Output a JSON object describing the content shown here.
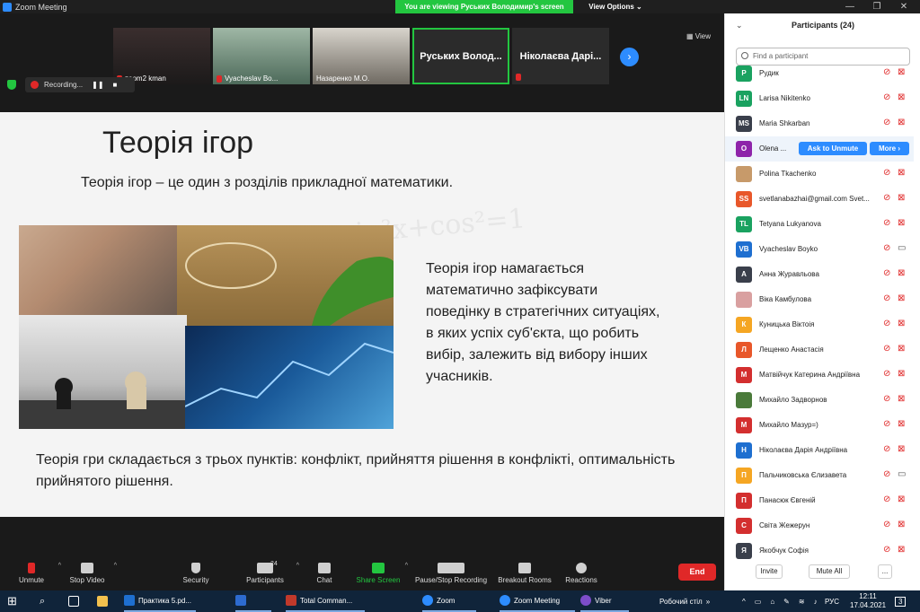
{
  "window": {
    "title": "Zoom Meeting",
    "banner": "You are viewing Руських Володимир's screen",
    "view_options": "View Options ⌄"
  },
  "thumbnails": [
    {
      "name": "zoom2 kman"
    },
    {
      "name": "Vyacheslav Bo..."
    },
    {
      "name": "Назаренко М.О."
    },
    {
      "name": "Руських  Волод..."
    },
    {
      "name": "Ніколаєва  Дарі..."
    }
  ],
  "view_label": "View",
  "recording": {
    "label": "Recording..."
  },
  "slide": {
    "title": "Теорія ігор",
    "subtitle": "Теорія ігор – це один з розділів прикладної математики.",
    "body": "   Теорія ігор намагається\nматематично зафіксувати\nповедінку в стратегічних ситуаціях,\nв яких успіх суб'єкта, що робить\nвибір, залежить від вибору інших\nучасників.",
    "footer": "Теорія гри складається з трьох пунктів: конфлікт, прийняття рішення в конфлікті, оптимальність прийнятого рішення.",
    "bg_text": "sin²x+cos²=1"
  },
  "toolbar": {
    "unmute": "Unmute",
    "stop_video": "Stop Video",
    "security": "Security",
    "participants": "Participants",
    "participants_count": "24",
    "chat": "Chat",
    "share_screen": "Share Screen",
    "pause_recording": "Pause/Stop Recording",
    "breakout": "Breakout Rooms",
    "reactions": "Reactions",
    "end": "End"
  },
  "panel": {
    "title": "Participants (24)",
    "search_placeholder": "Find a participant",
    "ask_to_unmute": "Ask to Unmute",
    "more": "More ›",
    "invite": "Invite",
    "mute_all": "Mute All",
    "dots": "...",
    "participants": [
      {
        "initials": "Р",
        "name": "Рудик",
        "color": "#1aa260",
        "video": "off"
      },
      {
        "initials": "LN",
        "name": "Larisa Nikitenko",
        "color": "#1aa260",
        "video": "off"
      },
      {
        "initials": "MS",
        "name": "Maria Shkarban",
        "color": "#3a3f4b",
        "video": "off"
      },
      {
        "initials": "O",
        "name": "Olena ...",
        "color": "#8e24aa",
        "video": "off"
      },
      {
        "initials": "",
        "name": "Polina Tkachenko",
        "color": "#c79a6a",
        "video": "off"
      },
      {
        "initials": "SS",
        "name": "svetlanabazhai@gmail.com Svet...",
        "color": "#e8572a",
        "video": "off"
      },
      {
        "initials": "TL",
        "name": "Tetyana Lukyanova",
        "color": "#1aa260",
        "video": "off"
      },
      {
        "initials": "VB",
        "name": "Vyacheslav Boyko",
        "color": "#1e6fd0",
        "video": "on"
      },
      {
        "initials": "А",
        "name": "Анна Журавльова",
        "color": "#3a3f4b",
        "video": "off"
      },
      {
        "initials": "",
        "name": "Віка Камбулова",
        "color": "#d9a0a0",
        "video": "off"
      },
      {
        "initials": "К",
        "name": "Куницька Віктоія",
        "color": "#f5a623",
        "video": "off"
      },
      {
        "initials": "Л",
        "name": "Лещенко Анастасія",
        "color": "#e8572a",
        "video": "off"
      },
      {
        "initials": "М",
        "name": "Матвійчук Катерина Андріївна",
        "color": "#d32f2f",
        "video": "off"
      },
      {
        "initials": "",
        "name": "Михайло Задворнов",
        "color": "#4a7a3a",
        "video": "off"
      },
      {
        "initials": "М",
        "name": "Михайло Мазур=)",
        "color": "#d32f2f",
        "video": "off"
      },
      {
        "initials": "Н",
        "name": "Ніколаєва Дарія Андріївна",
        "color": "#1e6fd0",
        "video": "off"
      },
      {
        "initials": "П",
        "name": "Пальчиковська Єлизавета",
        "color": "#f5a623",
        "video": "on"
      },
      {
        "initials": "П",
        "name": "Панасюк Євгеній",
        "color": "#d32f2f",
        "video": "off"
      },
      {
        "initials": "С",
        "name": "Світа Жежерун",
        "color": "#d32f2f",
        "video": "off"
      },
      {
        "initials": "Я",
        "name": "Якобчук Софія",
        "color": "#3a3f4b",
        "video": "off"
      }
    ]
  },
  "taskbar": {
    "items": [
      "Практика 5.pd...",
      "",
      "Total Comman...",
      "Zoom",
      "Zoom Meeting",
      "Viber"
    ],
    "desktop": "Робочий стіл",
    "lang": "РУС",
    "time": "12:11",
    "date": "17.04.2021",
    "notif": "3"
  }
}
